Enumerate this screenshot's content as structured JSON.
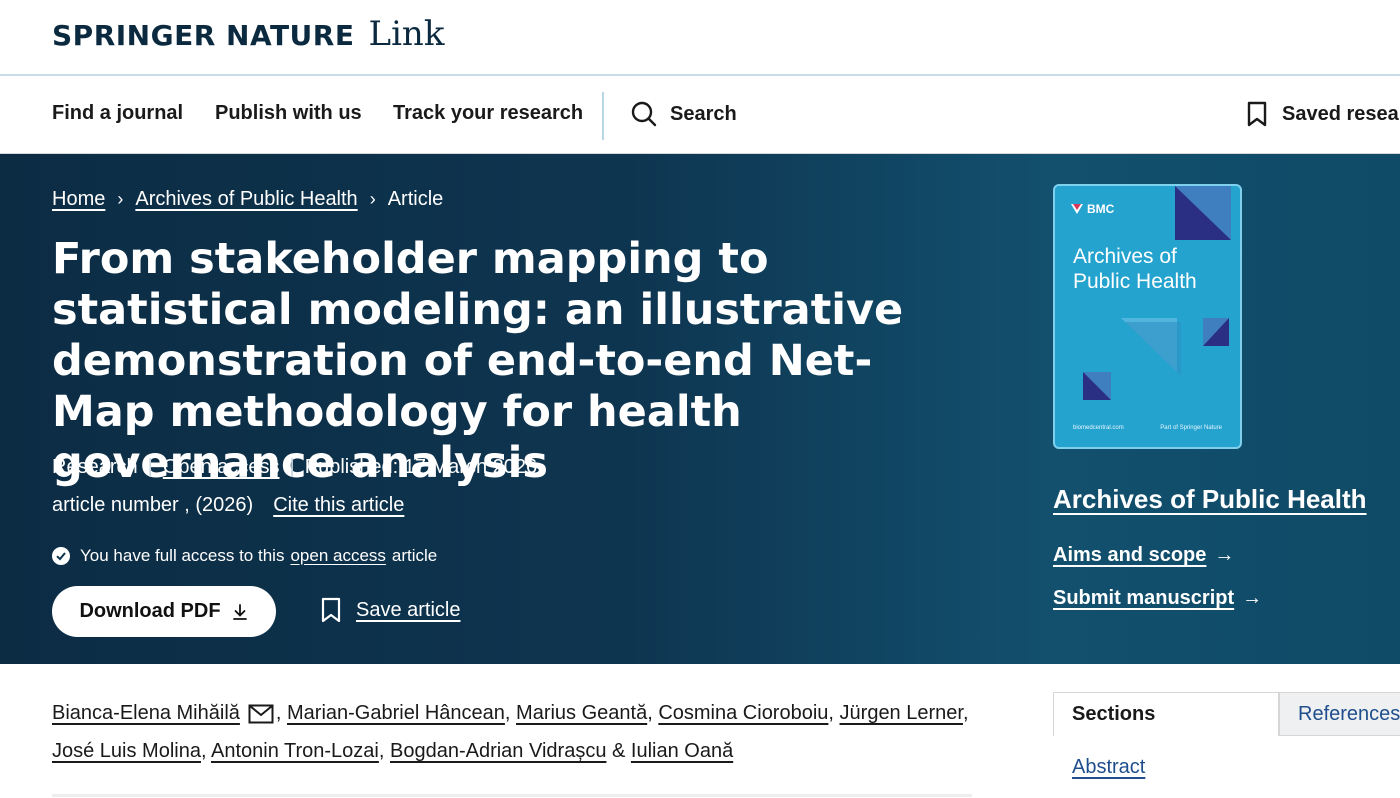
{
  "header": {
    "logo_brand": "SPRINGER NATURE",
    "logo_product": "Link"
  },
  "nav": {
    "find_journal": "Find a journal",
    "publish": "Publish with us",
    "track": "Track your research",
    "search": "Search",
    "saved": "Saved research"
  },
  "breadcrumb": {
    "home": "Home",
    "journal": "Archives of Public Health",
    "current": "Article"
  },
  "article": {
    "title": "From stakeholder mapping to statistical modeling: an illustrative demonstration of end-to-end Net-Map methodology for health governance analysis",
    "type": "Research",
    "access": "Open access",
    "published": "Published: 17 March 2026",
    "article_number": "article number , (2026)",
    "cite": "Cite this article",
    "access_notice_prefix": "You have full access to this",
    "access_notice_link": "open access",
    "access_notice_suffix": "article",
    "download_label": "Download PDF",
    "save_label": "Save article"
  },
  "journal": {
    "cover_publisher": "BMC",
    "cover_title": "Archives of Public Health",
    "cover_footer_left": "biomedcentral.com",
    "cover_footer_right": "Part of Springer Nature",
    "name": "Archives of Public Health",
    "aims": "Aims and scope",
    "submit": "Submit manuscript"
  },
  "authors": [
    "Bianca-Elena Mihăilă",
    "Marian-Gabriel Hâncean",
    "Marius Geantă",
    "Cosmina Cioroboiu",
    "Jürgen Lerner",
    "José Luis Molina",
    "Antonin Tron-Lozai",
    "Bogdan-Adrian Vidrașcu",
    "Iulian Oană"
  ],
  "authors_joiner": "&",
  "sidebar": {
    "tab_sections": "Sections",
    "tab_references": "References",
    "abstract_link": "Abstract"
  },
  "colors": {
    "hero_dark": "#0c2c44",
    "hero_light": "#12506e",
    "cover": "#25a3cf",
    "link_blue": "#1f4e8c"
  }
}
